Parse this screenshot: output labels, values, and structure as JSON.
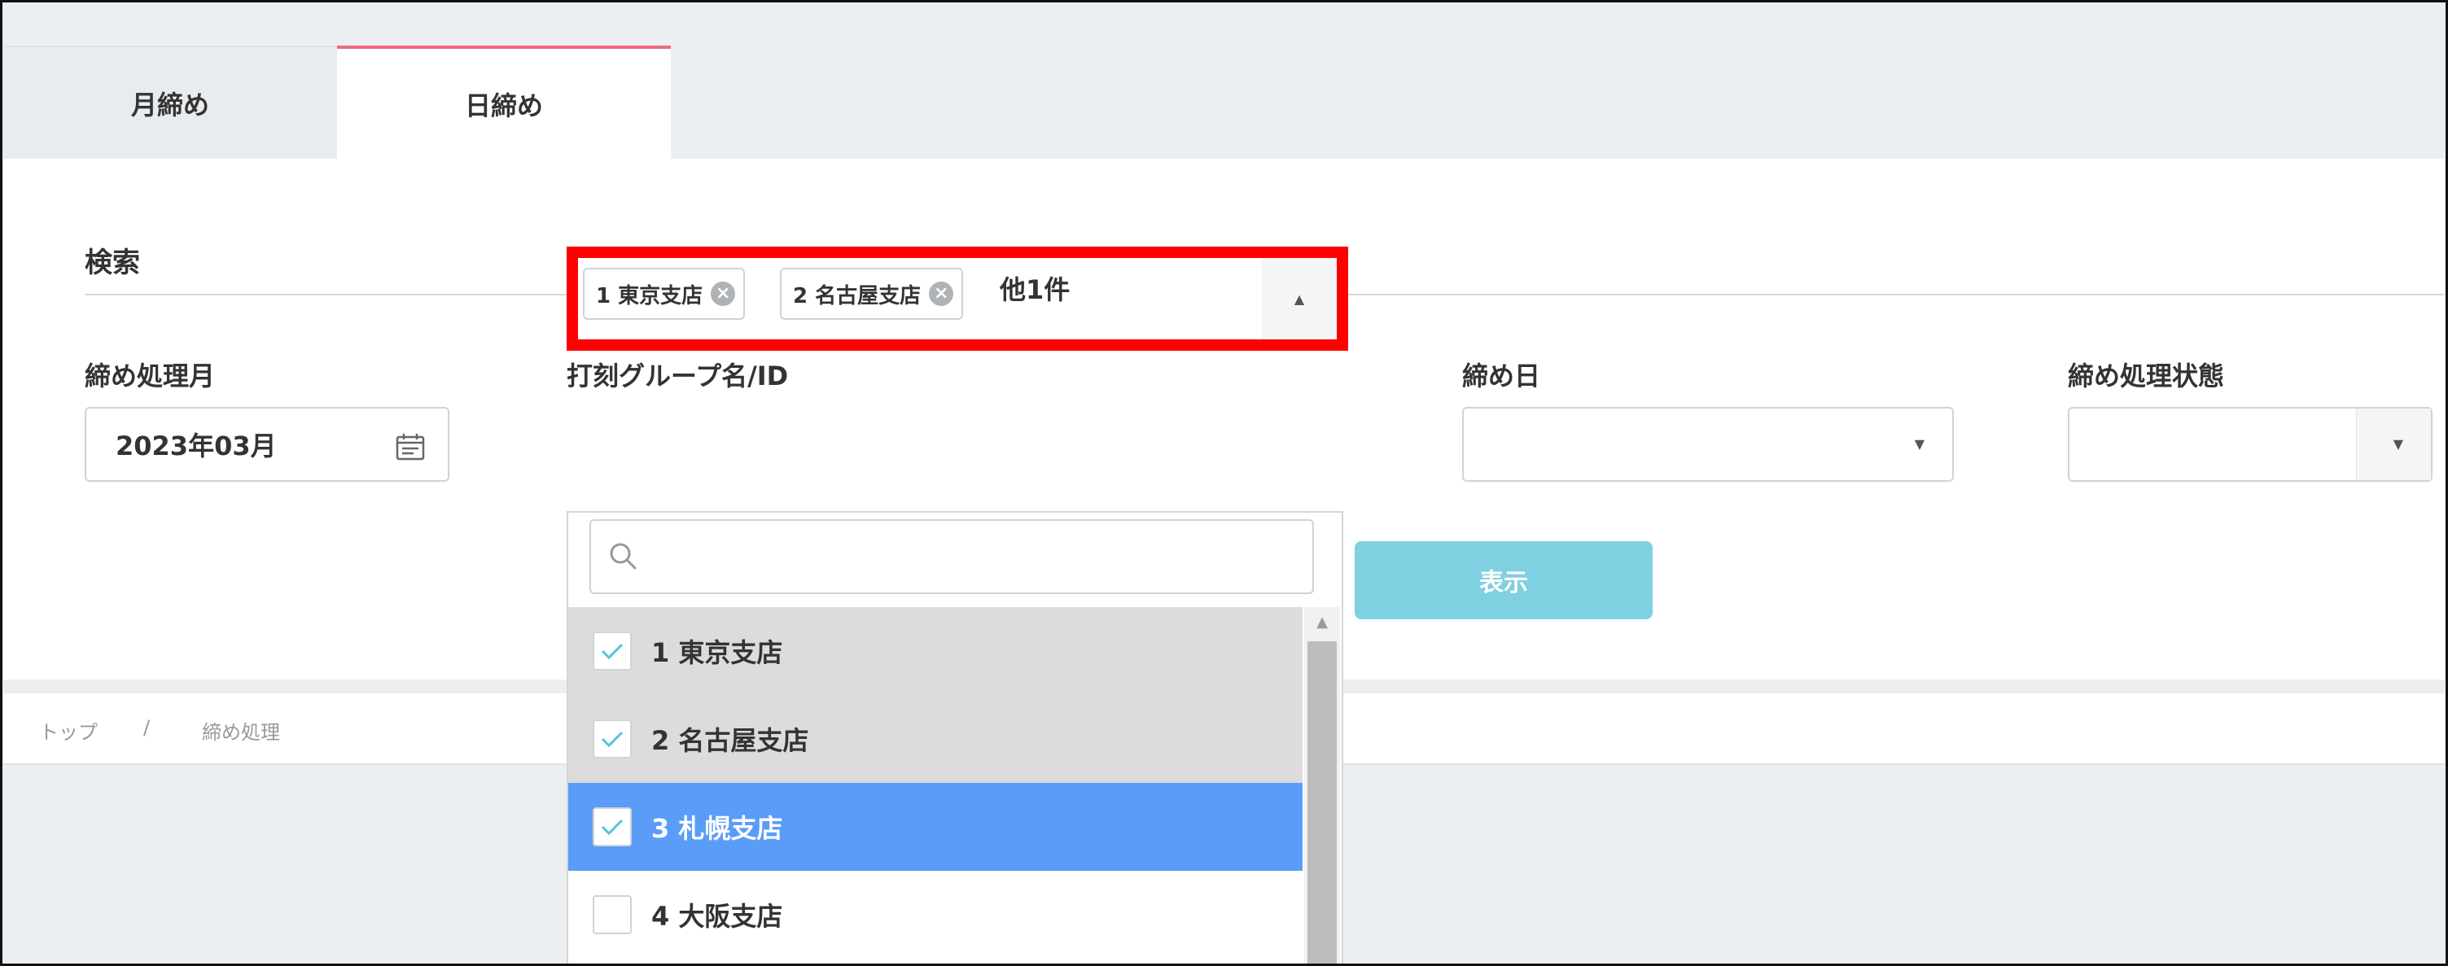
{
  "tabs": [
    {
      "label": "月締め",
      "active": false
    },
    {
      "label": "日締め",
      "active": true
    }
  ],
  "search": {
    "title": "検索",
    "month_label": "締め処理月",
    "month_value": "2023年03月",
    "group_label": "打刻グループ名/ID",
    "chips": [
      "1 東京支店",
      "2 名古屋支店"
    ],
    "others_text": "他1件",
    "close_day_label": "締め日",
    "close_day_value": "",
    "status_label": "締め処理状態",
    "status_value": "",
    "show_button": "表示"
  },
  "dropdown": {
    "search_placeholder": "",
    "items": [
      {
        "label": "1 東京支店",
        "checked": true,
        "state": "selected"
      },
      {
        "label": "2 名古屋支店",
        "checked": true,
        "state": "selected"
      },
      {
        "label": "3 札幌支店",
        "checked": true,
        "state": "highlighted"
      },
      {
        "label": "4 大阪支店",
        "checked": false,
        "state": "normal"
      }
    ]
  },
  "breadcrumb": {
    "home": "トップ",
    "separator": "/",
    "current": "締め処理"
  },
  "colors": {
    "active_tab_border": "#f06b78",
    "highlight_border": "#ff0000",
    "button": "#7fd0e1",
    "hover_item": "#5a9cf8",
    "check": "#5bc0de"
  },
  "icons": {
    "calendar": "calendar-icon",
    "search": "search-icon",
    "chip_remove": "close-circle-icon",
    "check": "check-icon"
  }
}
